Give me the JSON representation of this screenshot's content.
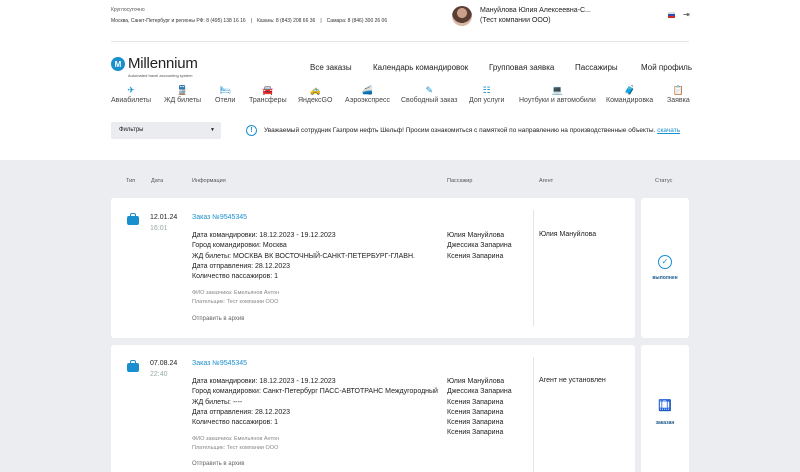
{
  "header": {
    "hours": "Круглосуточно",
    "phones": [
      "Москва, Санкт-Петербург и регионы РФ: 8 (495) 138 16 16",
      "Казань: 8 (843) 208 66 36",
      "Самара: 8 (846) 300 26 06"
    ],
    "user_name": "Мануйлова Юлия Алексеевна-С...",
    "user_company": "(Тест компании ООО)",
    "logout_icon": "logout-icon"
  },
  "logo": {
    "mark": "M",
    "name": "Millennium",
    "tagline": "Automated travel accounting system"
  },
  "main_nav": [
    "Все заказы",
    "Календарь командировок",
    "Групповая заявка",
    "Пассажиры",
    "Мой профиль"
  ],
  "services": [
    {
      "label": "Авиабилеты",
      "icon": "✈"
    },
    {
      "label": "ЖД билеты",
      "icon": "🚆"
    },
    {
      "label": "Отели",
      "icon": "🛏"
    },
    {
      "label": "Трансферы",
      "icon": "🚘"
    },
    {
      "label": "ЯндексGO",
      "icon": "🚕"
    },
    {
      "label": "Аэроэкспресс",
      "icon": "🚄"
    },
    {
      "label": "Свободный заказ",
      "icon": "✎"
    },
    {
      "label": "Доп услуги",
      "icon": "☷"
    },
    {
      "label": "Ноутбуки и автомобили",
      "icon": "💻"
    },
    {
      "label": "Командировка",
      "icon": "🧳"
    },
    {
      "label": "Заявка",
      "icon": "📋"
    }
  ],
  "filter": {
    "label": "Фильтры"
  },
  "notice": {
    "text": "Уважаемый сотрудник Газпром нефть Шельф! Просим ознакомиться с памяткой по направлению на производственные объекты.",
    "link": "скачать"
  },
  "columns": {
    "type": "Тип",
    "date": "Дата",
    "info": "Информация",
    "passenger": "Пассажир",
    "agent": "Агент",
    "status": "Статус"
  },
  "orders": [
    {
      "date": "12.01.24",
      "time": "16:01",
      "order": "Заказ №9545345",
      "details": [
        "Дата командировки: 18.12.2023 - 19.12.2023",
        "Город командировки: Москва",
        "ЖД билеты: МОСКВА ВК ВОСТОЧНЫЙ-САНКТ-ПЕТЕРБУРГ-ГЛАВН.",
        "Дата отправления: 28.12.2023",
        "Количество пассажиров: 1"
      ],
      "customer": "ФИО заказчика: Емельянов Антон",
      "payer": "Плательщик: Тест компании ООО",
      "archive": "Отправить в архив",
      "passengers": [
        "Юлия Мануйлова",
        "Джессика Запарина",
        "Ксения Запарина"
      ],
      "agent": "Юлия Мануйлова",
      "status": "выполнен",
      "status_icon": "✓"
    },
    {
      "date": "07.08.24",
      "time": "22:40",
      "order": "Заказ №9545345",
      "details": [
        "Дата командировки: 18.12.2023 - 19.12.2023",
        "Город командировки: Санкт-Петербург ПАСС-АВТОТРАНС Междугородный",
        "ЖД билеты: ----",
        "Дата отправления: 28.12.2023",
        "Количество пассажиров: 1"
      ],
      "customer": "ФИО заказчика: Емельянов Антон",
      "payer": "Плательщик: Тест компании ООО",
      "archive": "Отправить в архив",
      "passengers": [
        "Юлия Мануйлова",
        "Джессика Запарина",
        "Ксения Запарина",
        "Ксения Запарина",
        "Ксения Запарина",
        "Ксения Запарина"
      ],
      "agent": "Агент не установлен",
      "status": "заказан",
      "status_icon": "🛄"
    }
  ],
  "colors": {
    "accent": "#1a8fcf",
    "background": "#ecedf1"
  }
}
